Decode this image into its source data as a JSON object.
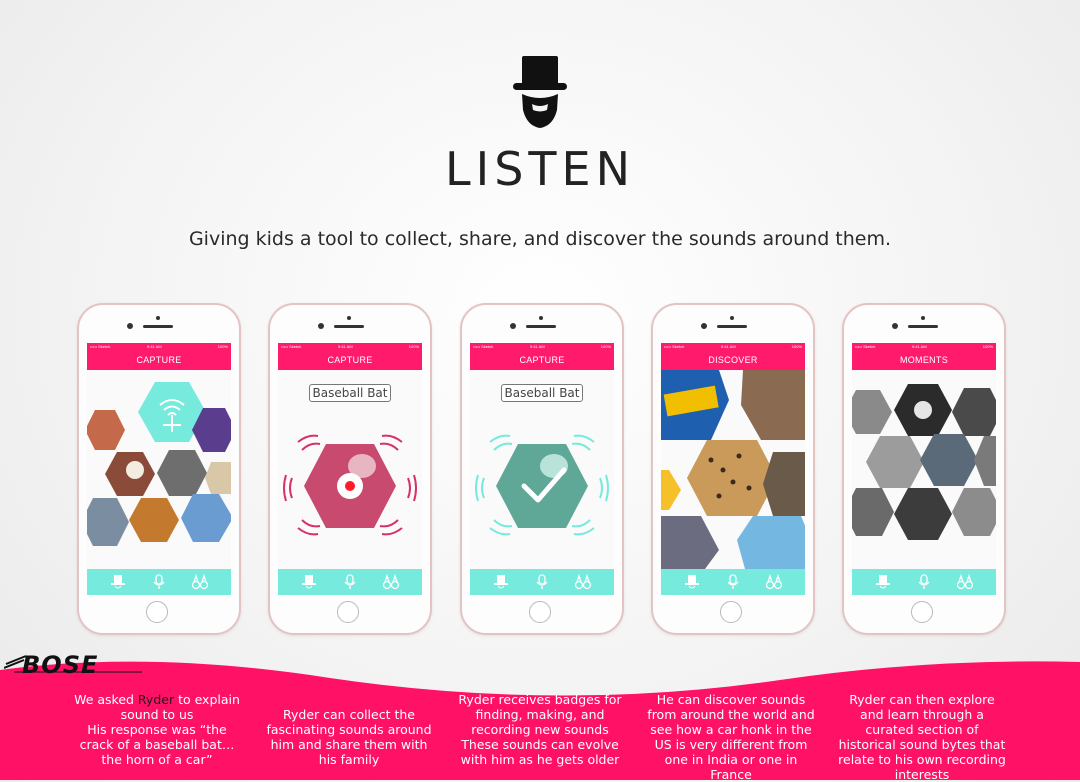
{
  "brand": {
    "title": "LISTEN",
    "tagline": "Giving kids a tool to collect, share, and discover the sounds around them."
  },
  "colors": {
    "accent_pink": "#ff1a6b",
    "accent_mint": "#76eadc",
    "wave_pink": "#ff1166"
  },
  "sponsor_logo": "BOSE",
  "phones": [
    {
      "nav_title": "CAPTURE",
      "status": {
        "carrier": "••••• Sketch",
        "time": "9:41 AM",
        "battery": "100%"
      },
      "tabs": [
        "hat-icon",
        "microphone-icon",
        "binoculars-icon"
      ]
    },
    {
      "nav_title": "CAPTURE",
      "pill_label": "Baseball Bat",
      "status": {
        "carrier": "••••• Sketch",
        "time": "9:41 AM",
        "battery": "100%"
      },
      "tabs": [
        "hat-icon",
        "microphone-icon",
        "binoculars-icon"
      ]
    },
    {
      "nav_title": "CAPTURE",
      "pill_label": "Baseball Bat",
      "status": {
        "carrier": "••••• Sketch",
        "time": "9:41 AM",
        "battery": "100%"
      },
      "tabs": [
        "hat-icon",
        "microphone-icon",
        "binoculars-icon"
      ]
    },
    {
      "nav_title": "DISCOVER",
      "status": {
        "carrier": "••••• Sketch",
        "time": "9:41 AM",
        "battery": "100%"
      },
      "tabs": [
        "hat-icon",
        "microphone-icon",
        "binoculars-icon"
      ]
    },
    {
      "nav_title": "MOMENTS",
      "status": {
        "carrier": "••••• Sketch",
        "time": "9:41 AM",
        "battery": "100%"
      },
      "tabs": [
        "hat-icon",
        "microphone-icon",
        "binoculars-icon"
      ]
    }
  ],
  "captions": [
    {
      "before": "We asked ",
      "highlight": "Ryder",
      "after": " to explain sound to us",
      "line2": "His response was “the crack of a baseball bat…the horn of a car”"
    },
    {
      "text": "Ryder can collect the fascinating sounds around him and share them with his family"
    },
    {
      "text": "Ryder receives badges for finding, making, and recording new sounds",
      "line2": "These sounds can evolve with him as he gets older"
    },
    {
      "text": "He can discover sounds from around the world and see how a car honk in the US is very different from one in India or one in France"
    },
    {
      "text": "Ryder can then explore and learn through a curated section of historical sound bytes that relate to his own recording interests"
    }
  ]
}
